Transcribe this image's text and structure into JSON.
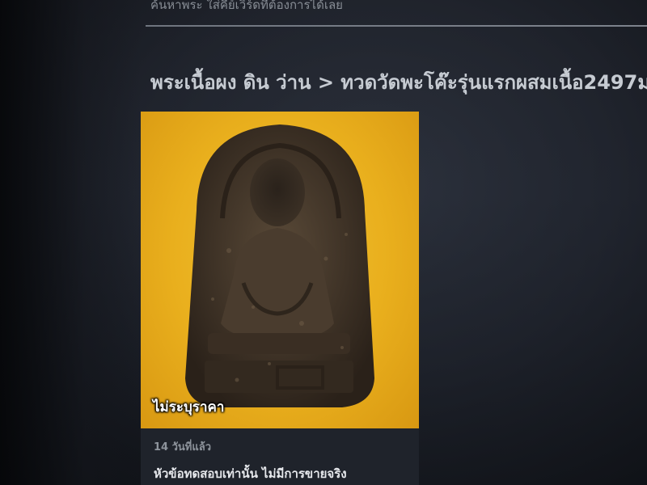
{
  "header": {
    "top_hint": "ค้นหาพระ  ใส่คีย์เวิร์ดที่ต้องการได้เลย",
    "title": "พระเนื้อผง ดิน ว่าน > ทวดวัดพะโค๊ะรุ่นแรกผสมเนื้อ2497ม"
  },
  "listing": {
    "image_icon": "amulet-photo",
    "price_label": "ไม่ระบุราคา",
    "posted_ago": "14 วันที่แล้ว",
    "subtitle": "หัวข้อทดสอบเท่านั้น ไม่มีการขายจริง"
  },
  "colors": {
    "background": "#1a1d24",
    "image_background": "#e9af1d",
    "title_text": "#c6cbd2"
  }
}
